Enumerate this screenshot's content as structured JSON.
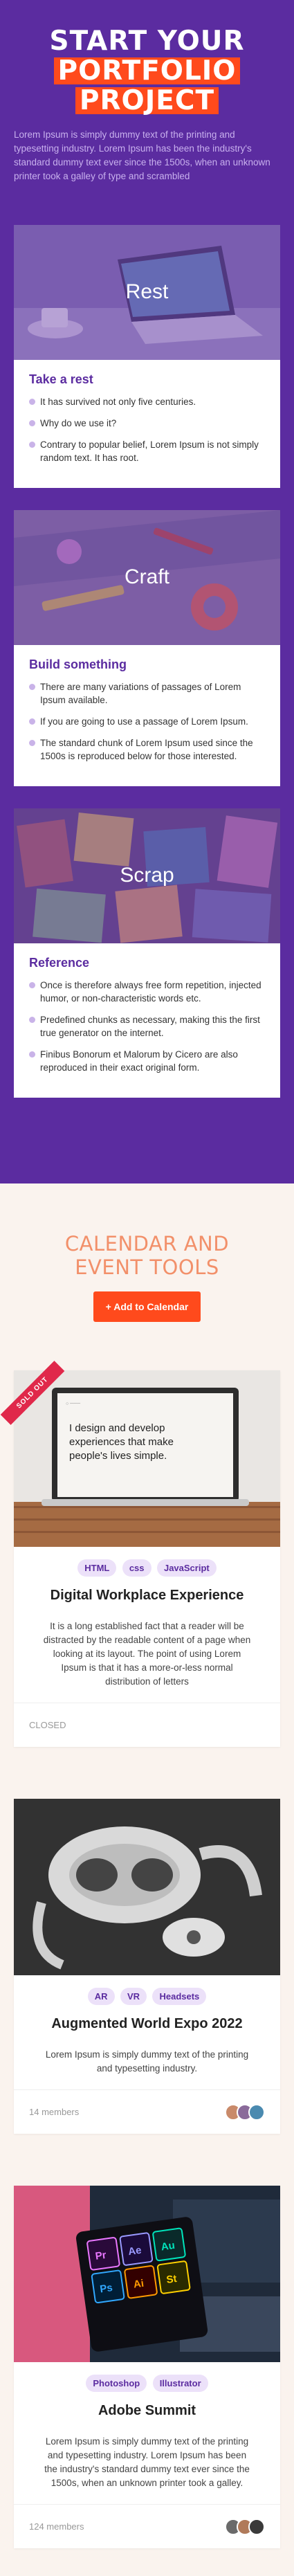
{
  "hero": {
    "title_line1": "START YOUR",
    "title_line2": "PORTFOLIO",
    "title_line3": "PROJECT",
    "description": "Lorem Ipsum is simply dummy text of the printing and typesetting industry. Lorem Ipsum has been the industry's standard dummy text ever since the 1500s, when an unknown printer took a galley of type and scrambled",
    "accent_color": "#ff4a1c",
    "background_color": "#5b2ca0"
  },
  "cards": [
    {
      "image_caption": "Rest",
      "heading": "Take a rest",
      "items": [
        "It has survived not only five centuries.",
        "Why do we use it?",
        "Contrary to popular belief, Lorem Ipsum is not simply random text. It has root."
      ]
    },
    {
      "image_caption": "Craft",
      "heading": "Build something",
      "items": [
        "There are many variations of passages of Lorem Ipsum available.",
        "If you are going to use a passage of Lorem Ipsum.",
        "The standard chunk of Lorem Ipsum used since the 1500s is reproduced below for those interested."
      ]
    },
    {
      "image_caption": "Scrap",
      "heading": "Reference",
      "items": [
        "Once is therefore always free form repetition, injected humor, or non-characteristic words etc.",
        "Predefined chunks as necessary, making this the first true generator on the internet.",
        "Finibus Bonorum et Malorum by Cicero are also reproduced in their exact original form."
      ]
    }
  ],
  "calendar": {
    "title_line1": "CALENDAR AND",
    "title_line2": "EVENT TOOLS",
    "add_button": "+ Add to Calendar"
  },
  "events": [
    {
      "ribbon": "SOLD OUT",
      "screen_text_1": "I design and develop",
      "screen_text_2": "experiences that make",
      "screen_text_3": "people's lives simple.",
      "tags": [
        "HTML",
        "css",
        "JavaScript"
      ],
      "title": "Digital Workplace Experience",
      "description": "It is a long established fact that a reader will be distracted by the readable content of a page when looking at its layout. The point of using Lorem Ipsum is that it has a more-or-less normal distribution of letters",
      "footer": "CLOSED"
    },
    {
      "tags": [
        "AR",
        "VR",
        "Headsets"
      ],
      "title": "Augmented World Expo 2022",
      "description": "Lorem Ipsum is simply dummy text of the printing and typesetting industry.",
      "footer": "14 members"
    },
    {
      "tags": [
        "Photoshop",
        "Illustrator"
      ],
      "app_icons": [
        "Pr",
        "Ae",
        "Au",
        "Ps",
        "Ai",
        "St"
      ],
      "title": "Adobe Summit",
      "description": "Lorem Ipsum is simply dummy text of the printing and typesetting industry. Lorem Ipsum has been the industry's standard dummy text ever since the 1500s, when an unknown printer took a galley.",
      "footer": "124 members"
    }
  ]
}
